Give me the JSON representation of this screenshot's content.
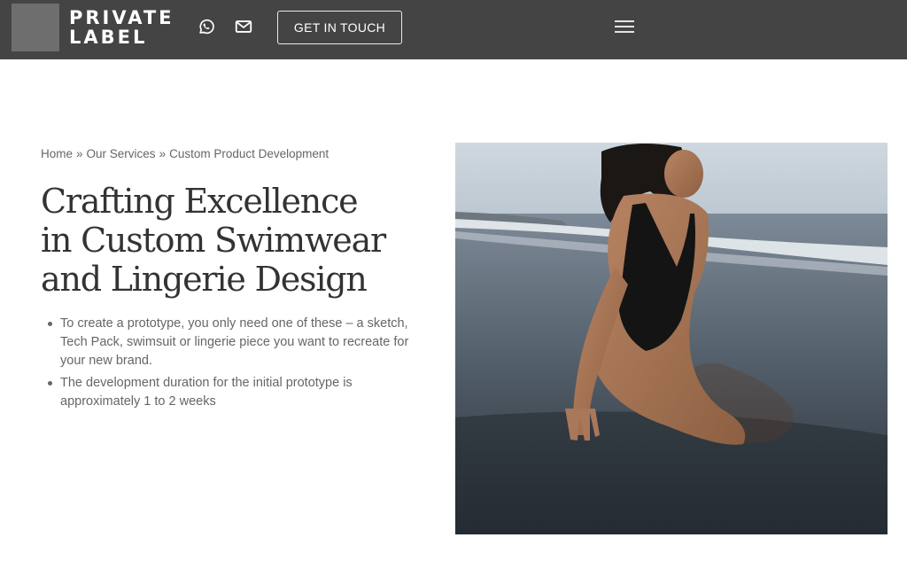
{
  "header": {
    "logo_line1": "PRIVATE",
    "logo_line2": "LABEL",
    "icons": [
      "whatsapp-icon",
      "mail-icon",
      "menu-icon"
    ],
    "cta_label": "GET IN TOUCH",
    "background": "#444444"
  },
  "breadcrumb": {
    "items": [
      "Home",
      "Our Services",
      "Custom Product Development"
    ],
    "separator": "»"
  },
  "hero": {
    "title_lines": [
      "Crafting Excellence",
      "in Custom Swimwear",
      "and Lingerie Design"
    ],
    "bullets": [
      "To create a prototype, you only need one of these – a sketch, Tech Pack, swimsuit or lingerie piece you want to recreate for your new brand.",
      "The development duration for the initial prototype is approximately 1 to 2 weeks"
    ]
  }
}
